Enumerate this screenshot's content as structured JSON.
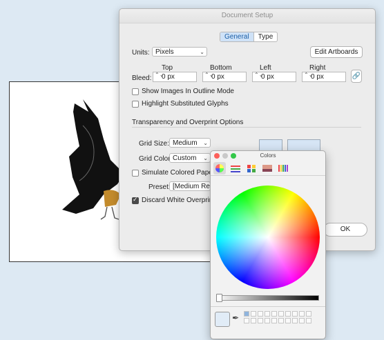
{
  "dialog": {
    "title": "Document Setup",
    "tabs": [
      {
        "label": "General",
        "active": true
      },
      {
        "label": "Type",
        "active": false
      }
    ],
    "units_label": "Units:",
    "units_value": "Pixels",
    "edit_artboards": "Edit Artboards",
    "bleed_label": "Bleed:",
    "bleed": [
      {
        "label": "Top",
        "value": "0 px"
      },
      {
        "label": "Bottom",
        "value": "0 px"
      },
      {
        "label": "Left",
        "value": "0 px"
      },
      {
        "label": "Right",
        "value": "0 px"
      }
    ],
    "show_images": {
      "label": "Show Images In Outline Mode",
      "checked": false
    },
    "highlight": {
      "label": "Highlight Substituted Glyphs",
      "checked": false
    },
    "section": "Transparency and Overprint Options",
    "grid_size_label": "Grid Size:",
    "grid_size_value": "Medium",
    "grid_colors_label": "Grid Colors:",
    "grid_colors_value": "Custom",
    "simulate": {
      "label": "Simulate Colored Paper",
      "checked": false
    },
    "preset_label": "Preset:",
    "preset_value": "[Medium Res",
    "discard": {
      "label": "Discard White Overprint",
      "checked": true
    },
    "ok": "OK"
  },
  "colors_panel": {
    "title": "Colors",
    "tools": [
      "color-wheel-icon",
      "sliders-icon",
      "palettes-icon",
      "image-palettes-icon",
      "pencils-icon"
    ],
    "current_color": "#e1ecf7"
  },
  "icons": {
    "chevron": "⌄",
    "stepper": "⌃⌄",
    "link": "🔗",
    "dropper": "✒"
  }
}
